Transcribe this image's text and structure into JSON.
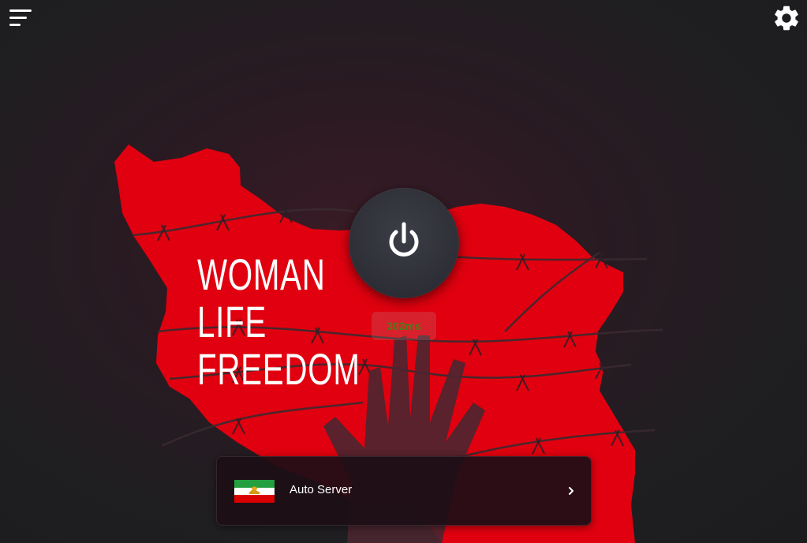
{
  "hero": {
    "slogan_lines": [
      "WOMAN",
      "LIFE",
      "FREEDOM"
    ]
  },
  "toolbar": {
    "menu_icon": "menu-lines-icon",
    "settings_icon": "gear-icon"
  },
  "connection": {
    "power_icon": "power-icon",
    "ping": "302ms"
  },
  "server": {
    "name": "Auto Server",
    "flag_icon": "iran-lion-and-sun-flag-icon",
    "arrow_icon": "chevron-right-icon"
  },
  "colors": {
    "map_red": "#e0000f",
    "power_button": "#30313a",
    "ping_text": "#4e7d16",
    "background": "#1f1e21"
  }
}
